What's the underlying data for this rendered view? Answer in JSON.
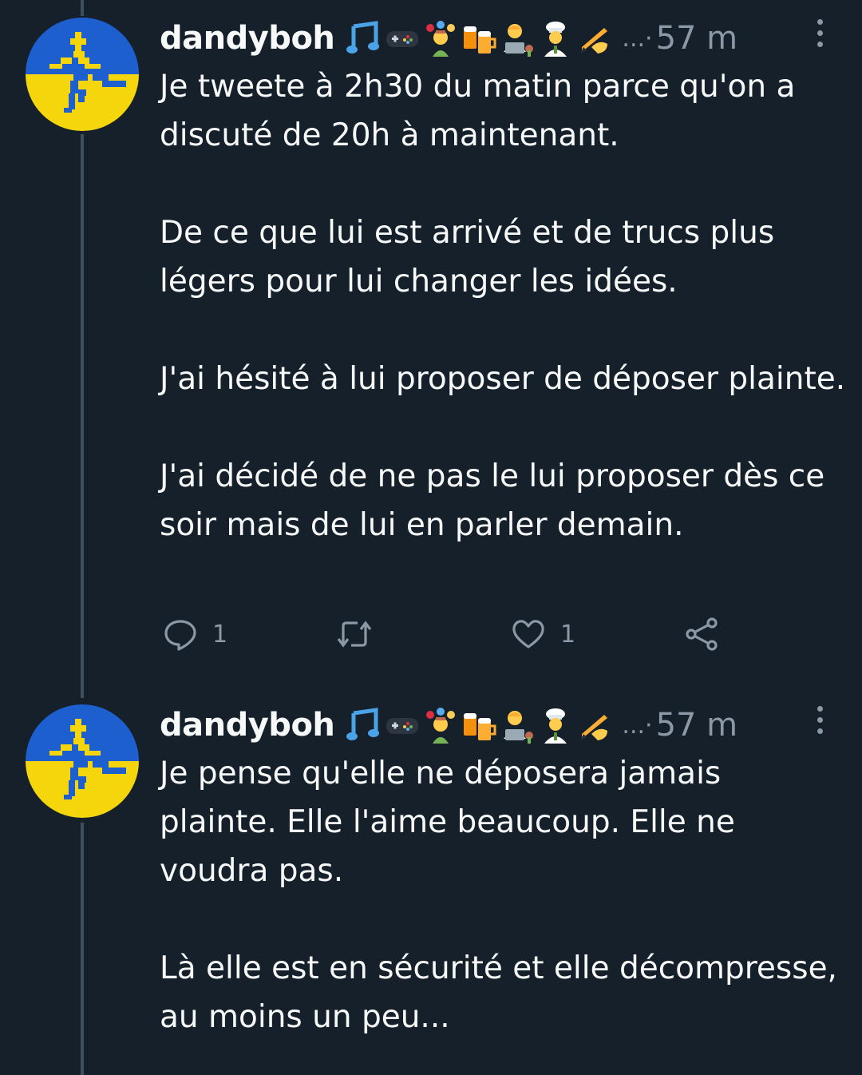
{
  "tweets": [
    {
      "author": "dandyboh",
      "emojis": [
        "music-notes-icon",
        "game-controller-icon",
        "juggler-icon",
        "beer-mugs-icon",
        "technologist-icon",
        "cook-icon",
        "writing-hand-icon"
      ],
      "overflow": "...·",
      "time": "57 m",
      "paragraphs": [
        "Je tweete à 2h30 du matin parce qu'on a discuté de 20h à maintenant.",
        "De ce que lui est arrivé et de trucs plus légers pour lui changer les idées.",
        "J'ai hésité à lui proposer de déposer plainte.",
        "J'ai décidé de ne pas le lui proposer dès ce soir mais de lui en parler demain."
      ],
      "reply_count": "1",
      "like_count": "1"
    },
    {
      "author": "dandyboh",
      "emojis": [
        "music-notes-icon",
        "game-controller-icon",
        "juggler-icon",
        "beer-mugs-icon",
        "technologist-icon",
        "cook-icon",
        "writing-hand-icon"
      ],
      "overflow": "...·",
      "time": "57 m",
      "paragraphs": [
        "Je pense qu'elle ne déposera jamais plainte. Elle l'aime beaucoup. Elle ne voudra pas.",
        "Là elle est en sécurité et elle décompresse, au moins un peu..."
      ]
    }
  ],
  "colors": {
    "background": "#15202b",
    "text": "#f7f9f9",
    "muted": "#8b98a5",
    "thread_line": "#3e4f5e",
    "avatar_blue": "#1e5fcf",
    "avatar_yellow": "#f5d50c"
  }
}
